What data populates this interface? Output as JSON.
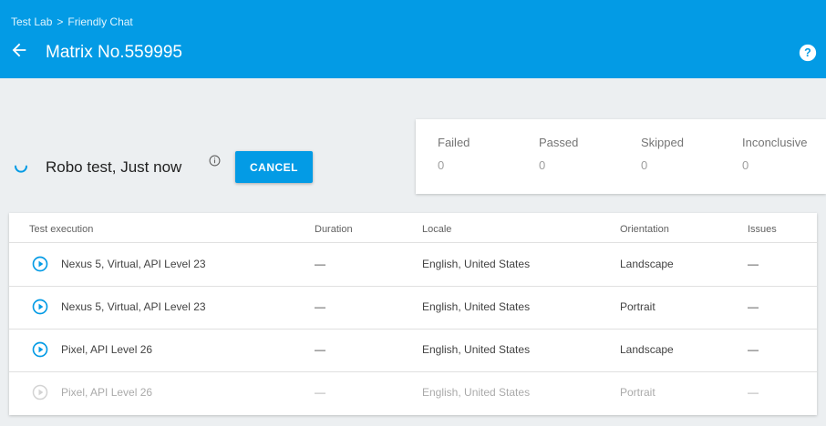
{
  "header": {
    "breadcrumb": [
      "Test Lab",
      "Friendly Chat"
    ],
    "breadcrumb_separator": ">",
    "title": "Matrix No.559995",
    "accent_color": "#039be5"
  },
  "run": {
    "label": "Robo test, Just now",
    "cancel_label": "CANCEL"
  },
  "summary": [
    {
      "label": "Failed",
      "value": "0"
    },
    {
      "label": "Passed",
      "value": "0"
    },
    {
      "label": "Skipped",
      "value": "0"
    },
    {
      "label": "Inconclusive",
      "value": "0"
    }
  ],
  "table": {
    "columns": [
      "Test execution",
      "Duration",
      "Locale",
      "Orientation",
      "Issues"
    ],
    "rows": [
      {
        "device": "Nexus 5, Virtual, API Level 23",
        "duration": "—",
        "locale": "English, United States",
        "orientation": "Landscape",
        "issues": "—",
        "enabled": true
      },
      {
        "device": "Nexus 5, Virtual, API Level 23",
        "duration": "—",
        "locale": "English, United States",
        "orientation": "Portrait",
        "issues": "—",
        "enabled": true
      },
      {
        "device": "Pixel, API Level 26",
        "duration": "—",
        "locale": "English, United States",
        "orientation": "Landscape",
        "issues": "—",
        "enabled": true
      },
      {
        "device": "Pixel, API Level 26",
        "duration": "—",
        "locale": "English, United States",
        "orientation": "Portrait",
        "issues": "—",
        "enabled": false
      }
    ]
  },
  "icons": {
    "back": "arrow-back-icon",
    "help": "help-icon",
    "info": "info-icon",
    "play": "play-circle-icon",
    "spinner": "spinner-icon"
  }
}
